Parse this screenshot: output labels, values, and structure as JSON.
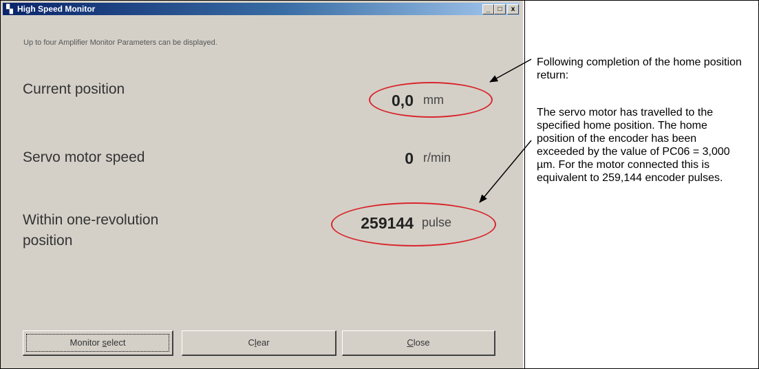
{
  "window": {
    "title": "High Speed Monitor",
    "icon": "app-icon",
    "hint": "Up to four Amplifier Monitor Parameters can be displayed.",
    "controls": {
      "minimize": "_",
      "maximize": "□",
      "close": "x"
    }
  },
  "monitor": {
    "rows": [
      {
        "label": "Current position",
        "value": "0,0",
        "unit": "mm",
        "highlighted": true
      },
      {
        "label": "Servo motor speed",
        "value": "0",
        "unit": "r/min",
        "highlighted": false
      },
      {
        "label_line1": "Within one-revolution",
        "label_line2": "position",
        "value": "259144",
        "unit": "pulse",
        "highlighted": true
      }
    ]
  },
  "buttons": {
    "monitor_select": {
      "pre": "Monitor ",
      "key": "s",
      "post": "elect"
    },
    "clear": {
      "pre": "C",
      "key": "l",
      "post": "ear"
    },
    "close": {
      "pre": "",
      "key": "C",
      "post": "lose"
    }
  },
  "annotations": {
    "note1": "Following completion of the home position return:",
    "note2": "The servo motor has travelled to the specified home position. The home position of the encoder has been exceeded by the value of PC06 = 3,000 µm. For the motor connected this is equivalent to 259,144 encoder pulses."
  },
  "colors": {
    "highlight": "#d9262c",
    "window_bg": "#d4d0c8",
    "titlebar": "#0a246a"
  }
}
